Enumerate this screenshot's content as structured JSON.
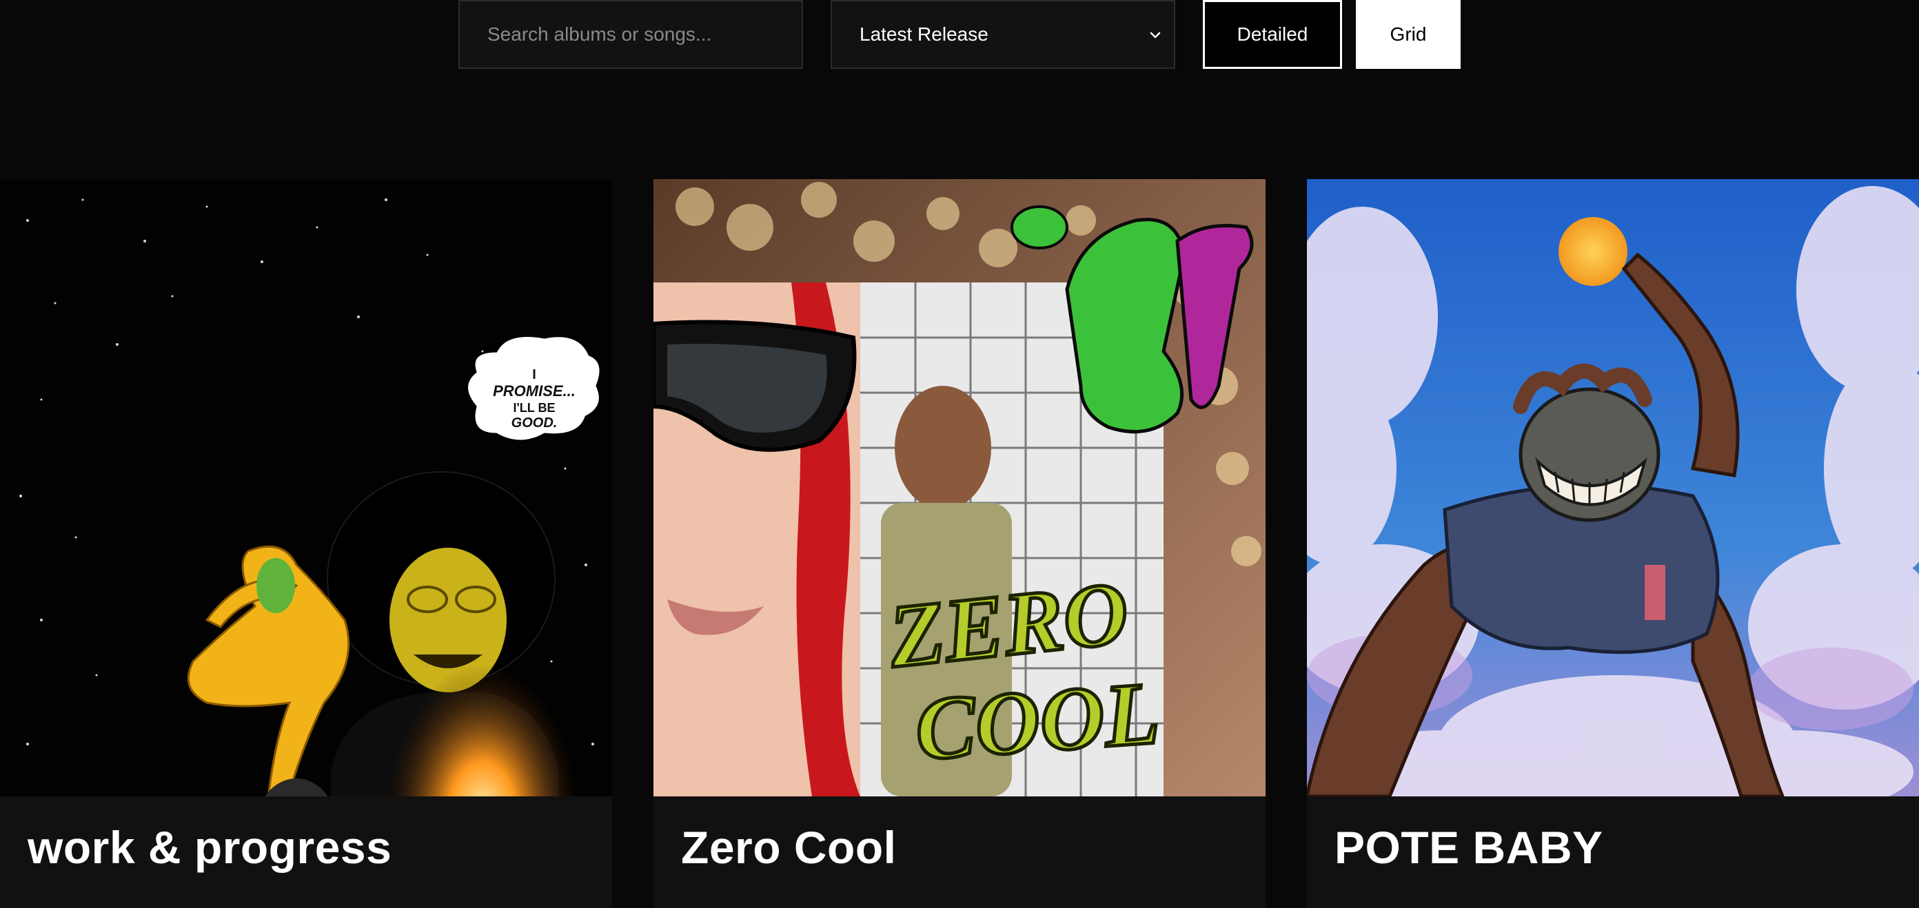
{
  "search": {
    "placeholder": "Search albums or songs..."
  },
  "sort": {
    "selected": "Latest Release"
  },
  "view_toggle": {
    "detailed_label": "Detailed",
    "grid_label": "Grid",
    "active": "Grid"
  },
  "albums": [
    {
      "title": "work & progress",
      "cover_text": "I PROMISE... I'LL BE GOOD."
    },
    {
      "title": "Zero Cool",
      "cover_text": "ZERO COOL"
    },
    {
      "title": "POTE BABY",
      "cover_text": ""
    }
  ],
  "colors": {
    "background": "#080808",
    "card": "#111111",
    "accent": "#ffffff"
  }
}
